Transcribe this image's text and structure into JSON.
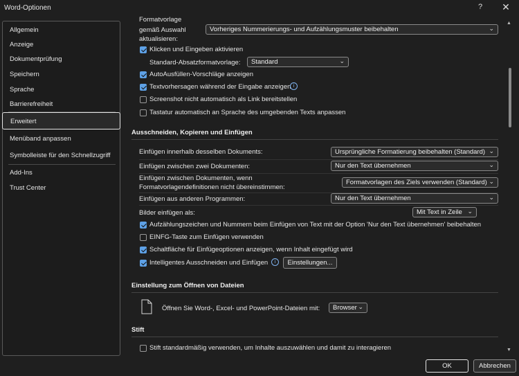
{
  "window": {
    "title": "Word-Optionen",
    "help": "?",
    "close": "✕"
  },
  "sidebar": {
    "items": [
      "Allgemein",
      "Anzeige",
      "Dokumentprüfung",
      "Speichern",
      "Sprache",
      "Barrierefreiheit",
      "Erweitert",
      "Menüband anpassen",
      "Symbolleiste für den Schnellzugriff",
      "Add-Ins",
      "Trust Center"
    ],
    "selected": "Erweitert"
  },
  "editing": {
    "format_label_1": "Formatvorlage",
    "format_label_2": "gemäß Auswahl",
    "format_label_3": "aktualisieren:",
    "format_value": "Vorheriges Nummerierungs- und Aufzählungsmuster beibehalten",
    "click_type": "Klicken und Eingeben aktivieren",
    "std_para_label": "Standard-Absatzformatvorlage:",
    "std_para_value": "Standard",
    "autofill": "AutoAusfüllen-Vorschläge anzeigen",
    "predictions": "Textvorhersagen während der Eingabe anzeigen",
    "screenshot_link": "Screenshot nicht automatisch als Link bereitstellen",
    "keyboard_lang": "Tastatur automatisch an Sprache des umgebenden Texts anpassen"
  },
  "cutcopy": {
    "heading": "Ausschneiden, Kopieren und Einfügen",
    "within_label": "Einfügen innerhalb desselben Dokuments:",
    "within_value": "Ursprüngliche Formatierung beibehalten (Standard)",
    "between_label": "Einfügen zwischen zwei Dokumenten:",
    "between_value": "Nur den Text übernehmen",
    "conflict_label_1": "Einfügen zwischen Dokumenten, wenn",
    "conflict_label_2": "Formatvorlagendefinitionen nicht übereinstimmen:",
    "conflict_value": "Formatvorlagen des Ziels verwenden (Standard)",
    "other_label": "Einfügen aus anderen Programmen:",
    "other_value": "Nur den Text übernehmen",
    "images_label": "Bilder einfügen als:",
    "images_value": "Mit Text in Zeile",
    "bullets": "Aufzählungszeichen und Nummern beim Einfügen von Text mit der Option 'Nur den Text übernehmen' beibehalten",
    "insert_key": "EINFG-Taste zum Einfügen verwenden",
    "paste_options": "Schaltfläche für Einfügeoptionen anzeigen, wenn Inhalt eingefügt wird",
    "smart_cut": "Intelligentes Ausschneiden und Einfügen",
    "settings_button": "Einstellungen..."
  },
  "open_files": {
    "heading": "Einstellung zum Öffnen von Dateien",
    "label": "Öffnen Sie Word-, Excel- und PowerPoint-Dateien mit:",
    "value": "Browser"
  },
  "pen": {
    "heading": "Stift",
    "option": "Stift standardmäßig verwenden, um Inhalte auszuwählen und damit zu interagieren"
  },
  "footer": {
    "ok": "OK",
    "cancel": "Abbrechen"
  },
  "icons": {
    "dropdown": "chevron-down-icon",
    "info": "info-icon",
    "file": "file-icon"
  },
  "colors": {
    "accent": "#5ea1e6",
    "background": "#1f1f1f"
  },
  "checkbox_states": {
    "click_type": true,
    "autofill": true,
    "predictions": true,
    "screenshot_link": false,
    "keyboard_lang": false,
    "bullets": true,
    "insert_key": false,
    "paste_options": true,
    "smart_cut": true,
    "pen": false
  }
}
